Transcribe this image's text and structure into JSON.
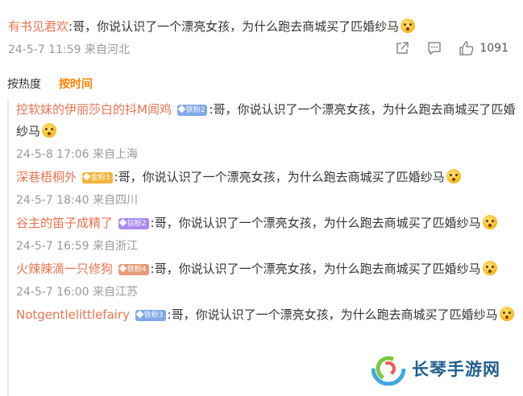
{
  "top_comment": {
    "username": "有书见君欢",
    "text": ":哥，你说认识了一个漂亮女孩，为什么跑去商城买了匹婚纱马",
    "emoji": "thinking-face-emoji",
    "meta": "24-5-7 11:59 来自河北",
    "like_count": "1091"
  },
  "sort_tabs": [
    "按热度",
    "按时间"
  ],
  "replies": [
    {
      "username": "控软妹的伊丽莎白的抖M闻鸡",
      "badge": "铁粉2",
      "badge_type": "iron",
      "text": ":哥，你说认识了一个漂亮女孩，为什么跑去商城买了匹婚纱马",
      "meta": "24-5-8 17:06 来自上海"
    },
    {
      "username": "深巷梧桐外",
      "badge": "金粉3",
      "badge_type": "gold",
      "text": ":哥，你说认识了一个漂亮女孩，为什么跑去商城买了匹婚纱马",
      "meta": "24-5-7 18:40 来自四川"
    },
    {
      "username": "谷主的笛子成精了",
      "badge": "钻粉2",
      "badge_type": "diamond",
      "text": ":哥，你说认识了一个漂亮女孩，为什么跑去商城买了匹婚纱马",
      "meta": "24-5-7 16:59 来自浙江"
    },
    {
      "username": "火辣辣滴一只修狗",
      "badge": "铁粉4",
      "badge_type": "iron",
      "text": ":哥，你说认识了一个漂亮女孩，为什么跑去商城买了匹婚纱马",
      "meta": "24-5-7 16:00 来自江苏"
    },
    {
      "username": "Notgentlelittlefairy",
      "badge": "铁粉3",
      "badge_type": "iron",
      "text": ":哥，你说认识了一个漂亮女孩，为什么跑去商城买了匹婚纱马",
      "meta": ""
    }
  ],
  "watermark": {
    "text": "长琴手游网"
  },
  "colors": {
    "username": "#eb7350",
    "active_tab": "#ff8200",
    "meta": "#9a9a9a",
    "watermark": "#1f5f8b"
  }
}
